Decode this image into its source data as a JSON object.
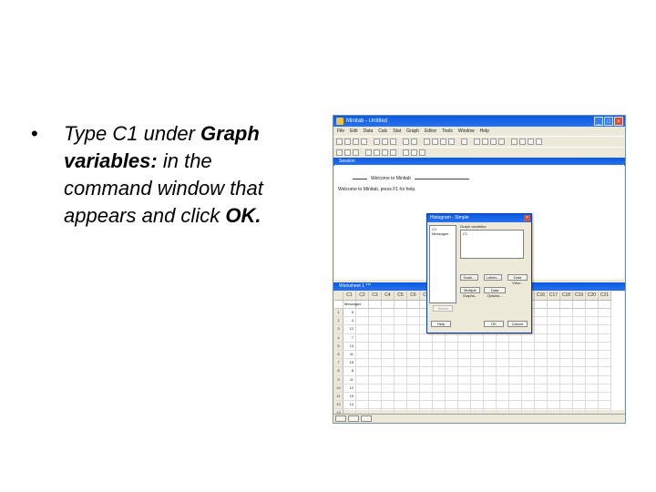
{
  "slide": {
    "bullet_symbol": "•",
    "line1_prefix": "Type C1 under ",
    "line1_bold": "Graph",
    "line2_bold": "variables:",
    "line2_rest": " in the",
    "line3": "command window that",
    "line4_prefix": "appears and click ",
    "line4_bold": "OK."
  },
  "app": {
    "title": "Minitab - Untitled",
    "menu": [
      "File",
      "Edit",
      "Data",
      "Calc",
      "Stat",
      "Graph",
      "Editor",
      "Tools",
      "Window",
      "Help"
    ]
  },
  "session": {
    "title": "Session",
    "header": "Welcome to Minitab",
    "text": "Welcome to Minitab, press F1 for help."
  },
  "worksheet": {
    "title": "Worksheet 1 ***",
    "columns": [
      "C1",
      "C2",
      "C3",
      "C4",
      "C5",
      "C6",
      "C7",
      "C8",
      "C9",
      "C10",
      "C11",
      "C12",
      "C13",
      "C14",
      "C15",
      "C16",
      "C17",
      "C18",
      "C19",
      "C20",
      "C21"
    ],
    "first_column_name": "Messages",
    "rows": [
      "1",
      "2",
      "3",
      "4",
      "5",
      "6",
      "7",
      "8",
      "9",
      "10",
      "11",
      "12",
      "13",
      "14"
    ],
    "c1_values": [
      "5",
      "4",
      "12",
      "7",
      "13",
      "11",
      "15",
      "8",
      "11",
      "12",
      "15",
      "14",
      "",
      ""
    ]
  },
  "dialog": {
    "title": "Histogram - Simple",
    "variable_list": [
      "C1  Messages"
    ],
    "graph_variables_label": "Graph variables:",
    "graph_variables_value": "C1",
    "buttons": {
      "scale": "Scale...",
      "labels": "Labels...",
      "data_view": "Data View...",
      "multiple_graphs": "Multiple Graphs...",
      "data_options": "Data Options...",
      "select": "Select",
      "help": "Help",
      "ok": "OK",
      "cancel": "Cancel"
    }
  },
  "colors": {
    "titlebar": "#0a5ae0",
    "chrome": "#ece9d8"
  }
}
